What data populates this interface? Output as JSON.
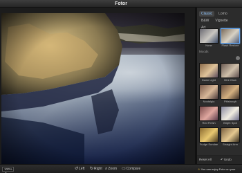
{
  "window": {
    "title": "Fotor"
  },
  "panel": {
    "tabs": [
      {
        "label": "Classic",
        "active": true
      },
      {
        "label": "Lomo",
        "active": false
      },
      {
        "label": "B&W",
        "active": false
      },
      {
        "label": "Vignette",
        "active": false
      },
      {
        "label": "Art",
        "active": false
      }
    ],
    "section_label": "Moods",
    "presets": [
      {
        "label": "None",
        "selected": false
      },
      {
        "label": "Flash Restore",
        "selected": true
      },
      {
        "label": "Dawn Light",
        "selected": false
      },
      {
        "label": "Mint Glow",
        "selected": false
      },
      {
        "label": "Nostalgia",
        "selected": false
      },
      {
        "label": "Pittsburgh",
        "selected": false
      },
      {
        "label": "Red Finish",
        "selected": false
      },
      {
        "label": "Bright Spot",
        "selected": false
      },
      {
        "label": "Fudge Sundae",
        "selected": false
      },
      {
        "label": "Straight Arm",
        "selected": false
      }
    ],
    "reset_label": "Reset All",
    "undo_label": "Undo"
  },
  "toolbar": {
    "zoom_value": "100%",
    "left_label": "Left",
    "right_label": "Right",
    "zoom_label": "Zoom",
    "compare_label": "Compare",
    "notice_text": "You can enjoy Fotor on your"
  },
  "colors": {
    "accent": "#8fc6ff",
    "selection": "#6ab0ff",
    "warning": "#f5c542"
  }
}
